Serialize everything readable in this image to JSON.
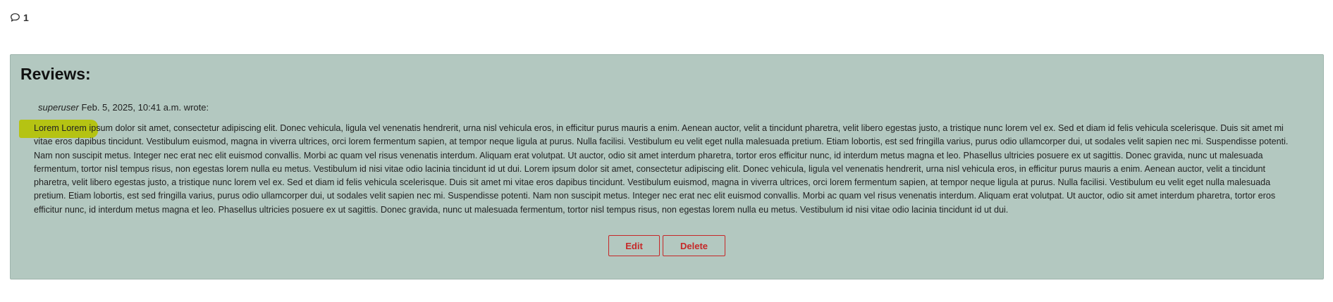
{
  "comments": {
    "icon": "comment-icon",
    "count": "1"
  },
  "reviews": {
    "title": "Reviews:",
    "items": [
      {
        "author": "superuser",
        "date_text": "Feb. 5, 2025, 10:41 a.m. wrote:",
        "body": "Lorem Lorem ipsum dolor sit amet, consectetur adipiscing elit. Donec vehicula, ligula vel venenatis hendrerit, urna nisl vehicula eros, in efficitur purus mauris a enim. Aenean auctor, velit a tincidunt pharetra, velit libero egestas justo, a tristique nunc lorem vel ex. Sed et diam id felis vehicula scelerisque. Duis sit amet mi vitae eros dapibus tincidunt. Vestibulum euismod, magna in viverra ultrices, orci lorem fermentum sapien, at tempor neque ligula at purus. Nulla facilisi. Vestibulum eu velit eget nulla malesuada pretium. Etiam lobortis, est sed fringilla varius, purus odio ullamcorper dui, ut sodales velit sapien nec mi. Suspendisse potenti. Nam non suscipit metus. Integer nec erat nec elit euismod convallis. Morbi ac quam vel risus venenatis interdum. Aliquam erat volutpat. Ut auctor, odio sit amet interdum pharetra, tortor eros efficitur nunc, id interdum metus magna et leo. Phasellus ultricies posuere ex ut sagittis. Donec gravida, nunc ut malesuada fermentum, tortor nisl tempus risus, non egestas lorem nulla eu metus. Vestibulum id nisi vitae odio lacinia tincidunt id ut dui. Lorem ipsum dolor sit amet, consectetur adipiscing elit. Donec vehicula, ligula vel venenatis hendrerit, urna nisl vehicula eros, in efficitur purus mauris a enim. Aenean auctor, velit a tincidunt pharetra, velit libero egestas justo, a tristique nunc lorem vel ex. Sed et diam id felis vehicula scelerisque. Duis sit amet mi vitae eros dapibus tincidunt. Vestibulum euismod, magna in viverra ultrices, orci lorem fermentum sapien, at tempor neque ligula at purus. Nulla facilisi. Vestibulum eu velit eget nulla malesuada pretium. Etiam lobortis, est sed fringilla varius, purus odio ullamcorper dui, ut sodales velit sapien nec mi. Suspendisse potenti. Nam non suscipit metus. Integer nec erat nec elit euismod convallis. Morbi ac quam vel risus venenatis interdum. Aliquam erat volutpat. Ut auctor, odio sit amet interdum pharetra, tortor eros efficitur nunc, id interdum metus magna et leo. Phasellus ultricies posuere ex ut sagittis. Donec gravida, nunc ut malesuada fermentum, tortor nisl tempus risus, non egestas lorem nulla eu metus. Vestibulum id nisi vitae odio lacinia tincidunt id ut dui.",
        "actions": {
          "edit_label": "Edit",
          "delete_label": "Delete"
        }
      }
    ]
  },
  "colors": {
    "panel_background": "#b3c8c0",
    "button_accent": "#c62828",
    "highlight": "#b5c200"
  }
}
